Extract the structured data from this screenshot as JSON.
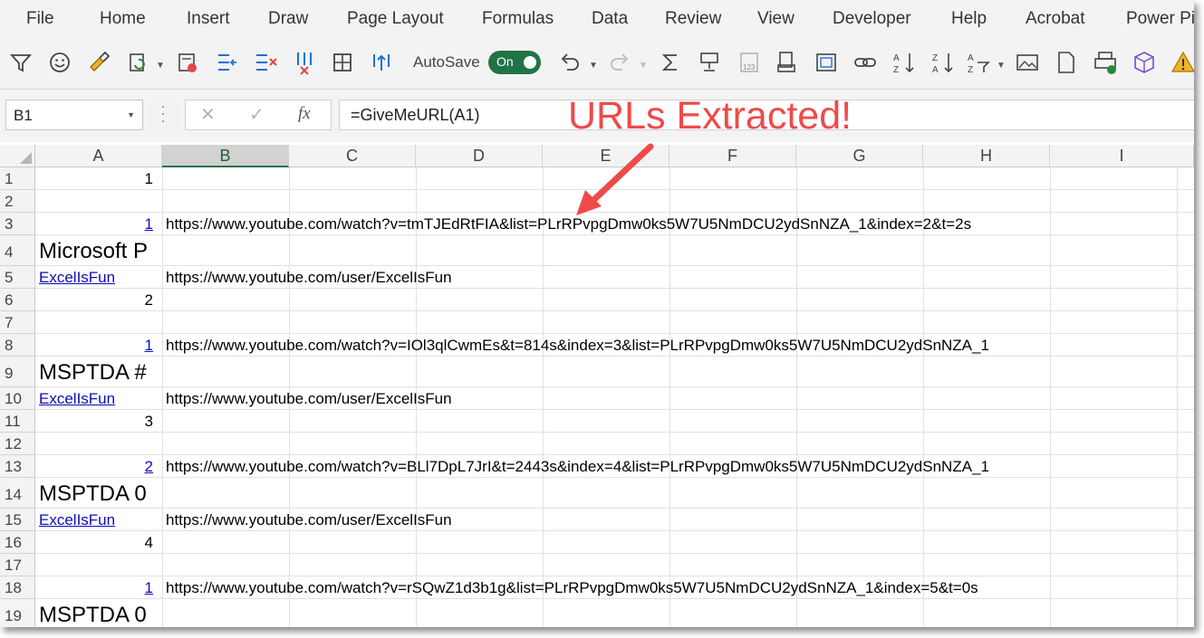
{
  "ribbon": {
    "tabs": [
      "File",
      "Home",
      "Insert",
      "Draw",
      "Page Layout",
      "Formulas",
      "Data",
      "Review",
      "View",
      "Developer",
      "Help",
      "Acrobat",
      "Power Pi"
    ]
  },
  "qat": {
    "autosave_label": "AutoSave",
    "autosave_state": "On",
    "icons": [
      "filter-icon",
      "smiley-icon",
      "format-painter-icon",
      "paste-values-icon",
      "clear-formats-icon",
      "insert-columns-icon",
      "delete-columns-icon",
      "freeze-panes-icon",
      "borders-icon",
      "sort-arrows-icon",
      "undo-icon",
      "redo-icon",
      "autosum-icon",
      "trophy-icon",
      "number-format-icon",
      "print-preview-icon",
      "page-setup-icon",
      "link-icon",
      "sort-az-icon",
      "sort-za-icon",
      "sort-custom-icon",
      "image-icon",
      "new-document-icon",
      "print-icon",
      "cube-icon",
      "warning-icon"
    ]
  },
  "formula_bar": {
    "name_box": "B1",
    "cancel_glyph": "✕",
    "enter_glyph": "✓",
    "fx_glyph": "fx",
    "formula": "=GiveMeURL(A1)"
  },
  "grid": {
    "columns": [
      "A",
      "B",
      "C",
      "D",
      "E",
      "F",
      "G",
      "H",
      "I"
    ],
    "selected_column": "B",
    "rows": [
      "1",
      "2",
      "3",
      "4",
      "5",
      "6",
      "7",
      "8",
      "9",
      "10",
      "11",
      "12",
      "13",
      "14",
      "15",
      "16",
      "17",
      "18",
      "19"
    ],
    "cells": {
      "A1": "1",
      "A3": "1",
      "B3": "https://www.youtube.com/watch?v=tmTJEdRtFIA&list=PLrRPvpgDmw0ks5W7U5NmDCU2ydSnNZA_1&index=2&t=2s",
      "A4": "Microsoft P",
      "A5": "ExcelIsFun",
      "B5": "https://www.youtube.com/user/ExcelIsFun",
      "A6": "2",
      "A8": "1",
      "B8": "https://www.youtube.com/watch?v=IOl3qlCwmEs&t=814s&index=3&list=PLrRPvpgDmw0ks5W7U5NmDCU2ydSnNZA_1",
      "A9": "MSPTDA #",
      "A10": "ExcelIsFun",
      "B10": "https://www.youtube.com/user/ExcelIsFun",
      "A11": "3",
      "A13": "2",
      "B13": "https://www.youtube.com/watch?v=BLl7DpL7JrI&t=2443s&index=4&list=PLrRPvpgDmw0ks5W7U5NmDCU2ydSnNZA_1",
      "A14": "MSPTDA 0",
      "A15": "ExcelIsFun",
      "B15": "https://www.youtube.com/user/ExcelIsFun",
      "A16": "4",
      "A18": "1",
      "B18": "https://www.youtube.com/watch?v=rSQwZ1d3b1g&list=PLrRPvpgDmw0ks5W7U5NmDCU2ydSnNZA_1&index=5&t=0s",
      "A19": "MSPTDA 0"
    }
  },
  "annotation": {
    "text": "URLs Extracted!",
    "color": "#ef4a4a"
  },
  "colors": {
    "excel_green": "#217346",
    "link_blue": "#0b0bb8"
  }
}
